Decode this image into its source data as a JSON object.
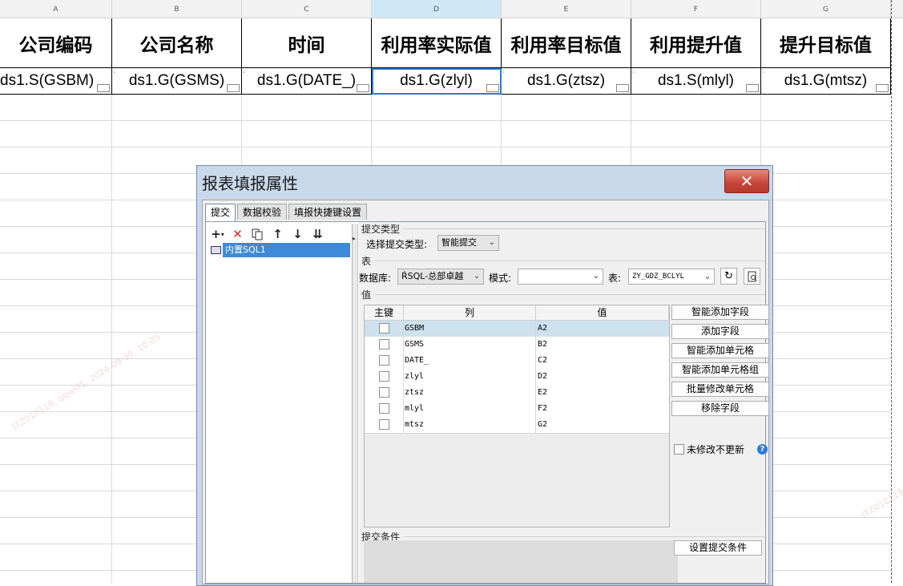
{
  "sheet": {
    "column_letters": [
      "A",
      "B",
      "C",
      "D",
      "E",
      "F",
      "G"
    ],
    "headers": [
      "公司编码",
      "公司名称",
      "时间",
      "利用率实际值",
      "利用率目标值",
      "利用提升值",
      "提升目标值"
    ],
    "cells": [
      "ds1.S(GSBM)",
      "ds1.G(GSMS)",
      "ds1.G(DATE_)",
      "ds1.G(zlyl)",
      "ds1.G(ztsz)",
      "ds1.S(mlyl)",
      "ds1.G(mtsz)"
    ],
    "active_column": "D",
    "watermark": "ITZ010118. qqwkl1. 2024-09-30. 10:05"
  },
  "dialog": {
    "title": "报表填报属性",
    "close_glyph": "✕",
    "tabs": [
      "提交",
      "数据校验",
      "填报快捷键设置"
    ],
    "active_tab": "提交",
    "toolbar_icons": [
      "add-icon",
      "delete-icon",
      "copy-icon",
      "arrow-up-icon",
      "arrow-down-icon",
      "move-bottom-icon"
    ],
    "tree_item": "内置SQL1",
    "submit_type": {
      "section": "提交类型",
      "label": "选择提交类型:",
      "value": "智能提交"
    },
    "table_section": {
      "section": "表",
      "db_label": "数据库:",
      "db_value": "ŔSQL-总部卓越",
      "mode_label": "模式:",
      "mode_value": "",
      "table_label": "表:",
      "table_value": "ZY_GDZ_BCLYL"
    },
    "value_section": {
      "section": "值",
      "columns": [
        "主键",
        "列",
        "值"
      ],
      "rows": [
        {
          "col": "GSBM",
          "val": "A2",
          "selected": true
        },
        {
          "col": "GSMS",
          "val": "B2",
          "selected": false
        },
        {
          "col": "DATE_",
          "val": "C2",
          "selected": false
        },
        {
          "col": "zlyl",
          "val": "D2",
          "selected": false
        },
        {
          "col": "ztsz",
          "val": "E2",
          "selected": false
        },
        {
          "col": "mlyl",
          "val": "F2",
          "selected": false
        },
        {
          "col": "mtsz",
          "val": "G2",
          "selected": false
        }
      ],
      "buttons": [
        "智能添加字段",
        "添加字段",
        "智能添加单元格",
        "智能添加单元格组",
        "批量修改单元格",
        "移除字段"
      ],
      "no_update_label": "未修改不更新"
    },
    "condition": {
      "section": "提交条件",
      "button": "设置提交条件"
    }
  },
  "colors": {
    "accent": "#2b7bd8",
    "selection": "#3d8bd8",
    "close_red": "#c8483a",
    "dialog_frame": "#c9d8ea"
  }
}
